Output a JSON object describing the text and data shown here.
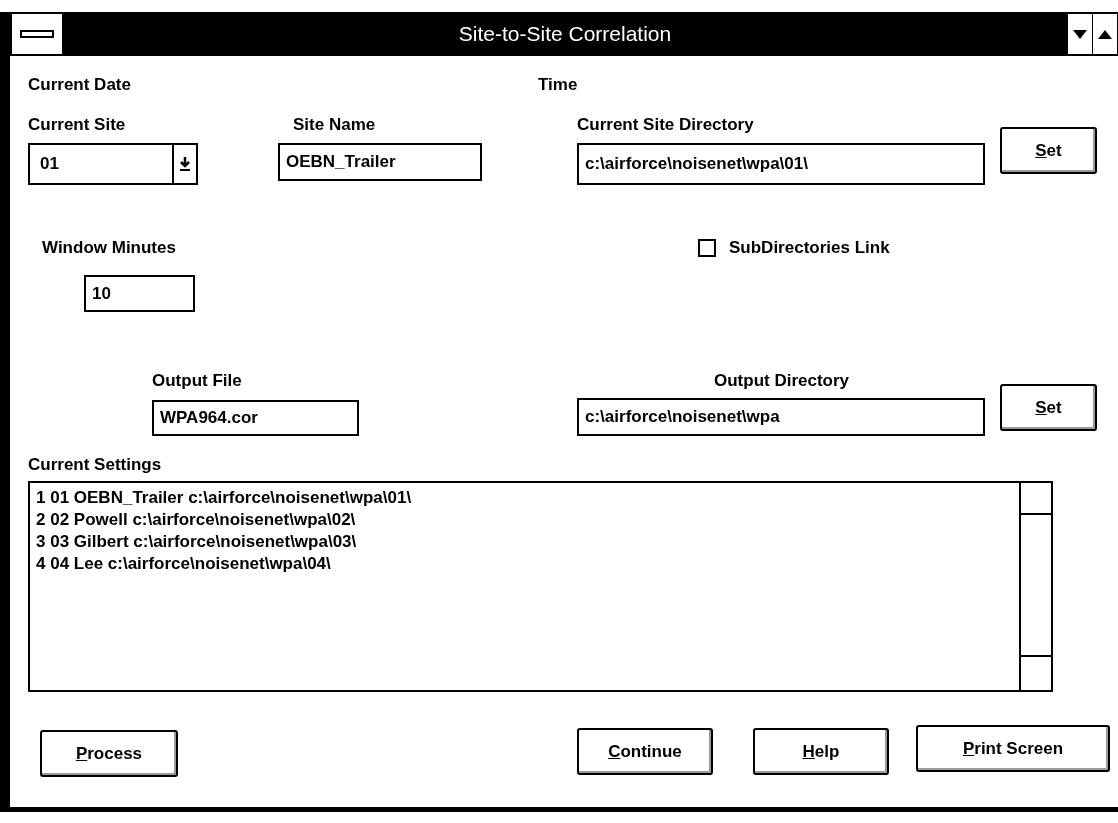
{
  "window": {
    "title": "Site-to-Site Correlation"
  },
  "header": {
    "date_label": "Current Date",
    "time_label": "Time"
  },
  "current_site": {
    "label": "Current Site",
    "value": "01"
  },
  "site_name": {
    "label": "Site Name",
    "value": "OEBN_Trailer"
  },
  "current_site_directory": {
    "label": "Current Site Directory",
    "value": "c:\\airforce\\noisenet\\wpa\\01\\",
    "button": {
      "accel": "S",
      "rest": "et"
    }
  },
  "window_minutes": {
    "label": "Window Minutes",
    "value": "10"
  },
  "subdirectories_link": {
    "label": "SubDirectories Link",
    "checked": false
  },
  "output_file": {
    "label": "Output File",
    "value": "WPA964.cor"
  },
  "output_directory": {
    "label": "Output Directory",
    "value": "c:\\airforce\\noisenet\\wpa",
    "button": {
      "accel": "S",
      "rest": "et"
    }
  },
  "current_settings": {
    "label": "Current Settings",
    "items": [
      "1 01 OEBN_Trailer c:\\airforce\\noisenet\\wpa\\01\\",
      "2 02 Powell c:\\airforce\\noisenet\\wpa\\02\\",
      "3 03 Gilbert c:\\airforce\\noisenet\\wpa\\03\\",
      "4 04 Lee c:\\airforce\\noisenet\\wpa\\04\\"
    ]
  },
  "buttons": [
    {
      "kind": "process",
      "accel": "P",
      "rest": "rocess"
    },
    {
      "kind": "continue",
      "accel": "C",
      "rest": "ontinue"
    },
    {
      "kind": "help",
      "accel": "H",
      "rest": "elp"
    },
    {
      "kind": "print",
      "accel": "P",
      "rest": "rint Screen"
    }
  ]
}
